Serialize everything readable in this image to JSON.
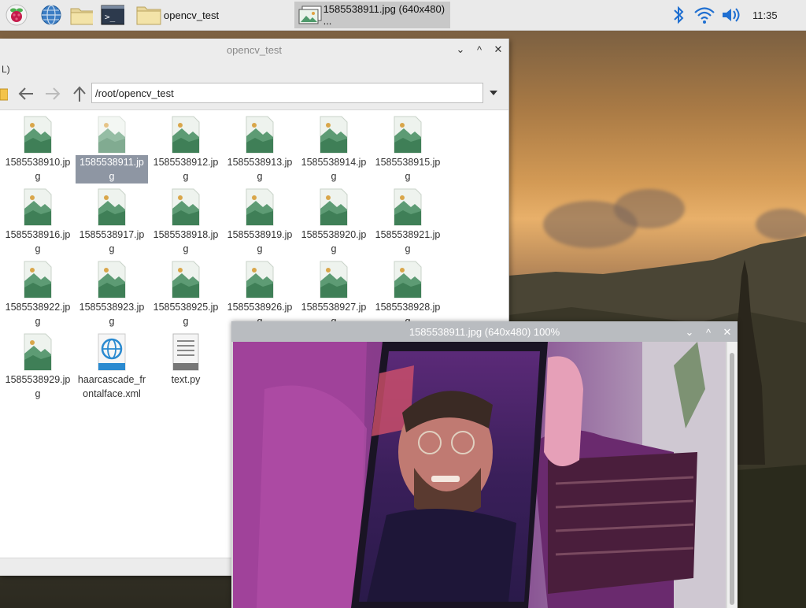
{
  "taskbar": {
    "launchers": [
      {
        "icon": "raspberry-icon"
      },
      {
        "icon": "browser-globe-icon"
      },
      {
        "icon": "file-manager-icon"
      },
      {
        "icon": "terminal-icon"
      }
    ],
    "tasks": [
      {
        "label": "opencv_test",
        "icon": "folder-icon",
        "active": false
      },
      {
        "label": "1585538911.jpg (640x480) ...",
        "icon": "image-icon",
        "active": true
      }
    ],
    "tray": {
      "bluetooth": "bluetooth-icon",
      "wifi": "wifi-icon",
      "volume": "volume-icon",
      "clock": "11:35"
    }
  },
  "file_manager": {
    "title": "opencv_test",
    "menu_fragment": "L)",
    "path": "/root/opencv_test",
    "files": [
      {
        "name": "1585538910.jpg",
        "type": "image",
        "selected": false
      },
      {
        "name": "1585538911.jpg",
        "type": "image",
        "selected": true
      },
      {
        "name": "1585538912.jpg",
        "type": "image",
        "selected": false
      },
      {
        "name": "1585538913.jpg",
        "type": "image",
        "selected": false
      },
      {
        "name": "1585538914.jpg",
        "type": "image",
        "selected": false
      },
      {
        "name": "1585538915.jpg",
        "type": "image",
        "selected": false
      },
      {
        "name": "1585538916.jpg",
        "type": "image",
        "selected": false
      },
      {
        "name": "1585538917.jpg",
        "type": "image",
        "selected": false
      },
      {
        "name": "1585538918.jpg",
        "type": "image",
        "selected": false
      },
      {
        "name": "1585538919.jpg",
        "type": "image",
        "selected": false
      },
      {
        "name": "1585538920.jpg",
        "type": "image",
        "selected": false
      },
      {
        "name": "1585538921.jpg",
        "type": "image",
        "selected": false
      },
      {
        "name": "1585538922.jpg",
        "type": "image",
        "selected": false
      },
      {
        "name": "1585538923.jpg",
        "type": "image",
        "selected": false
      },
      {
        "name": "1585538925.jpg",
        "type": "image",
        "selected": false
      },
      {
        "name": "1585538926.jpg",
        "type": "image",
        "selected": false
      },
      {
        "name": "1585538927.jpg",
        "type": "image",
        "selected": false
      },
      {
        "name": "1585538928.jpg",
        "type": "image",
        "selected": false
      },
      {
        "name": "1585538929.jpg",
        "type": "image",
        "selected": false
      },
      {
        "name": "haarcascade_frontalface.xml",
        "type": "xml",
        "selected": false
      },
      {
        "name": "text.py",
        "type": "text",
        "selected": false
      }
    ]
  },
  "image_viewer": {
    "title": "1585538911.jpg (640x480) 100%"
  },
  "colors": {
    "taskbar_bg": "#eaeaea",
    "selection": "#8e96a3",
    "viewer_titlebar": "#b9bcc0"
  }
}
